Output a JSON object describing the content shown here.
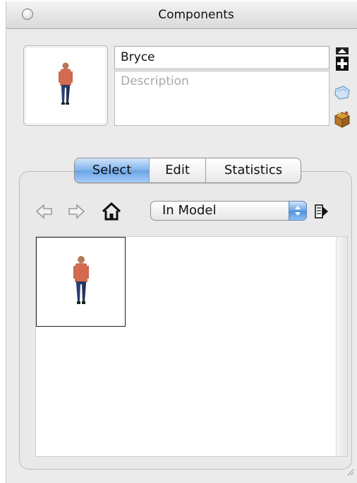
{
  "window": {
    "title": "Components"
  },
  "component": {
    "name": "Bryce",
    "description_placeholder": "Description"
  },
  "tabs": [
    {
      "label": "Select",
      "active": true
    },
    {
      "label": "Edit",
      "active": false
    },
    {
      "label": "Statistics",
      "active": false
    }
  ],
  "navigation": {
    "collection_selected": "In Model"
  },
  "icons": {
    "close": "close-button",
    "back": "back-arrow-icon",
    "forward": "forward-arrow-icon",
    "home": "home-icon",
    "details": "details-arrow-icon",
    "create_component": "create-component-icon",
    "paint_component": "paint-component-icon",
    "component_box": "component-box-icon",
    "resize": "resize-grip-icon"
  },
  "colors": {
    "active_tab": "#7fb2ec",
    "window_bg": "#ebebeb"
  }
}
